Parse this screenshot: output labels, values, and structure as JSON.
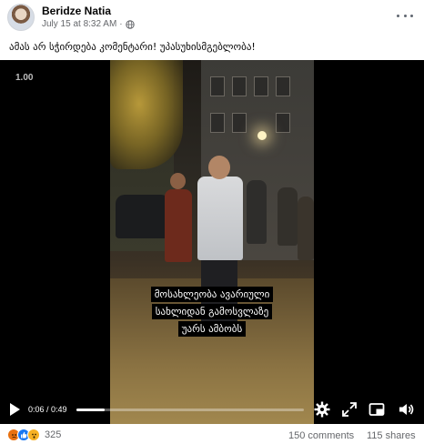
{
  "post": {
    "author": "Beridze Natia",
    "timestamp": "July 15 at 8:32 AM",
    "separator": "·",
    "audience_icon": "globe-icon",
    "caption": "ამას არ სჭირდება კომენტარი!  უპასუხისმგებლობა!"
  },
  "video": {
    "quality_label": "1.00",
    "subtitle_lines": [
      "მოსახლეობა ავარიული",
      "სახლიდან გამოსვლაზე",
      "უარს ამბობს"
    ],
    "current_time": "0:06",
    "duration": "0:49",
    "time_display": "0:06 / 0:49",
    "progress_fraction": 0.122,
    "icons": [
      "play-icon",
      "settings-icon",
      "fullscreen-icon",
      "picture-in-picture-icon",
      "volume-icon"
    ]
  },
  "footer": {
    "reaction_icons": [
      "angry-icon",
      "like-icon",
      "wow-icon"
    ],
    "reaction_count": "325",
    "comments": "150 comments",
    "shares": "115 shares"
  },
  "colors": {
    "brand_blue": "#1877f2",
    "meta_gray": "#65676b",
    "angry": "#e9710f",
    "wow": "#f7b125"
  }
}
